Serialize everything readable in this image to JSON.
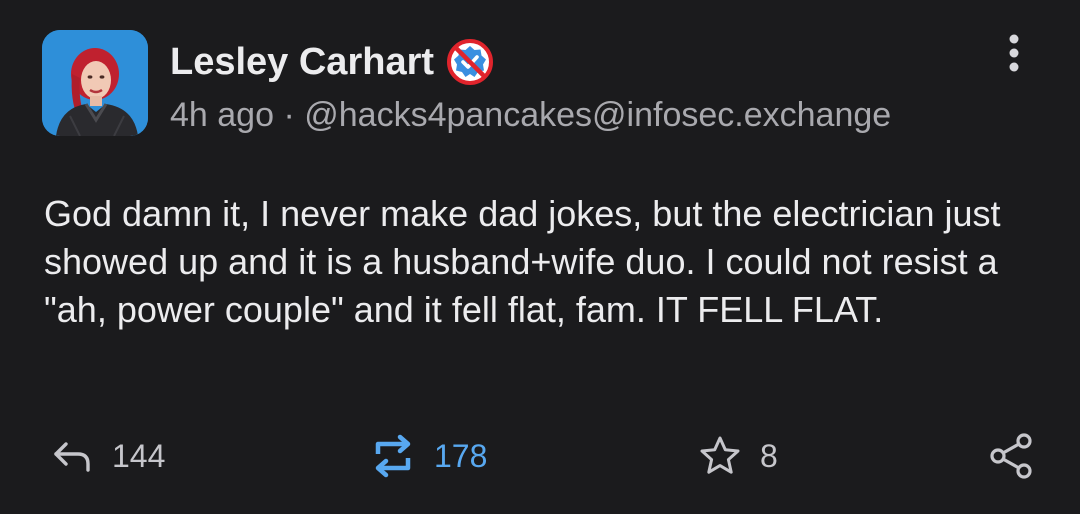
{
  "post": {
    "author": {
      "display_name": "Lesley Carhart",
      "badge_icon": "verified-crossed-out-icon",
      "badge_colors": {
        "ring": "#e0242c",
        "badge": "#3a8fe0"
      }
    },
    "time_ago": "4h ago",
    "separator": "·",
    "handle": "@hacks4pancakes@infosec.exchange",
    "more_icon": "vertical-dots-icon",
    "content": "God damn it, I never make dad jokes, but the electrician just showed up and it is a husband+wife duo. I could not resist a \"ah, power couple\" and it fell flat, fam. IT FELL FLAT.",
    "actions": {
      "reply": {
        "icon": "reply-icon",
        "count": "144"
      },
      "boost": {
        "icon": "boost-icon",
        "count": "178",
        "color": "#58a8f0"
      },
      "favourite": {
        "icon": "star-icon",
        "count": "8"
      },
      "share": {
        "icon": "share-icon"
      }
    }
  }
}
